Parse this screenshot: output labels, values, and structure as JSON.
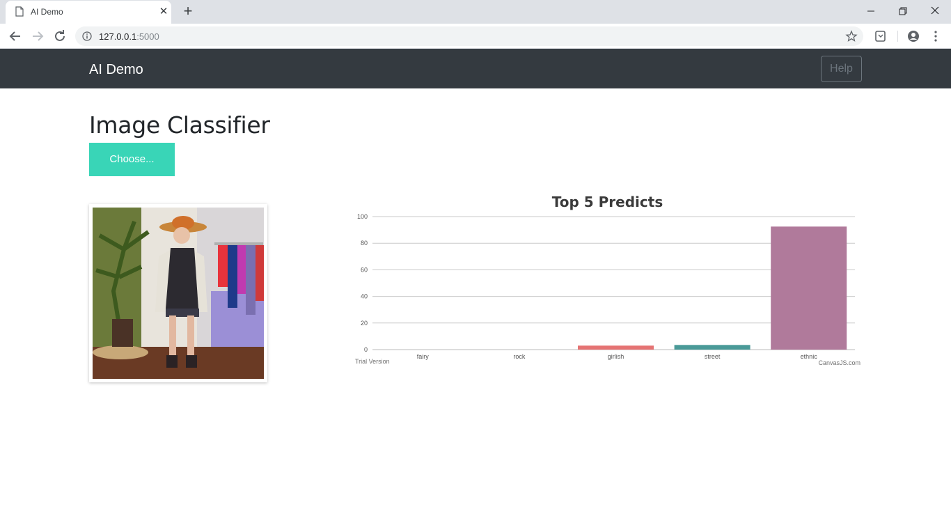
{
  "browser": {
    "tab_title": "AI Demo",
    "url_host": "127.0.0.1",
    "url_port": ":5000"
  },
  "app": {
    "brand": "AI Demo",
    "help_label": "Help",
    "page_title": "Image Classifier",
    "choose_label": "Choose..."
  },
  "colors": {
    "navbar": "#343a40",
    "accent": "#39d5b7"
  },
  "chart_data": {
    "type": "bar",
    "title": "Top 5 Predicts",
    "categories": [
      "fairy",
      "rock",
      "girlish",
      "street",
      "ethnic"
    ],
    "values": [
      0,
      0,
      3,
      3.5,
      92.5
    ],
    "colors": [
      "#4f81bc",
      "#c0504e",
      "#e57373",
      "#4a9a98",
      "#b07a9b"
    ],
    "ylim": [
      0,
      100
    ],
    "yticks": [
      0,
      20,
      40,
      60,
      80,
      100
    ],
    "grid": true,
    "xlabel": "",
    "ylabel": "",
    "watermark": "Trial Version",
    "credit": "CanvasJS.com"
  }
}
